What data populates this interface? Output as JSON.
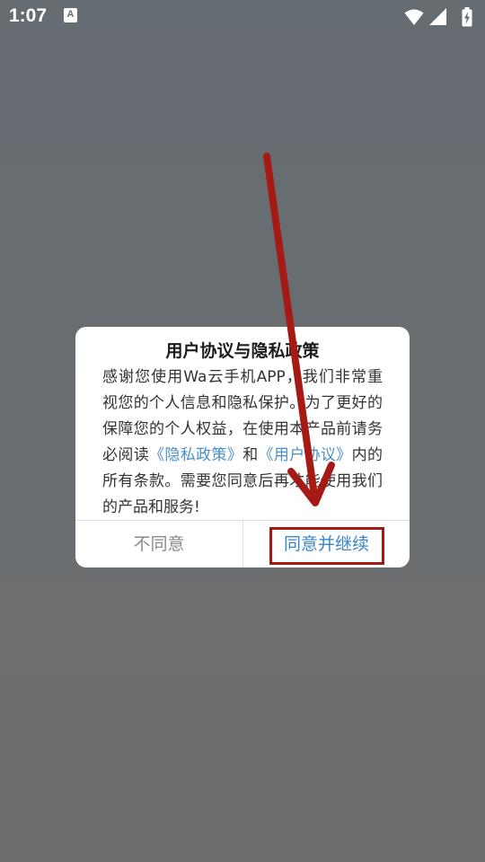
{
  "status_bar": {
    "time": "1:07",
    "notification_icon_letter": "A",
    "icons": [
      "wifi-icon",
      "signal-icon",
      "battery-charging-icon"
    ]
  },
  "dialog": {
    "title": "用户协议与隐私政策",
    "body": {
      "text_before": "感谢您使用Wa云手机APP，我们非常重视您的个人信息和隐私保护。为了更好的保障您的个人权益，在使用本产品前请务必阅读",
      "privacy_link": "《隐私政策》",
      "conjunction": "和",
      "user_agreement_link": "《用户协议》",
      "text_after": "内的所有条款。需要您同意后再才能使用我们的产品和服务!"
    },
    "buttons": {
      "disagree": "不同意",
      "agree": "同意并继续"
    }
  },
  "colors": {
    "overlay_background": "#676d71",
    "link": "#4a90c8",
    "agree_button": "#3a86c9",
    "disagree_button": "#8a8a8a",
    "annotation": "#a51a14"
  }
}
